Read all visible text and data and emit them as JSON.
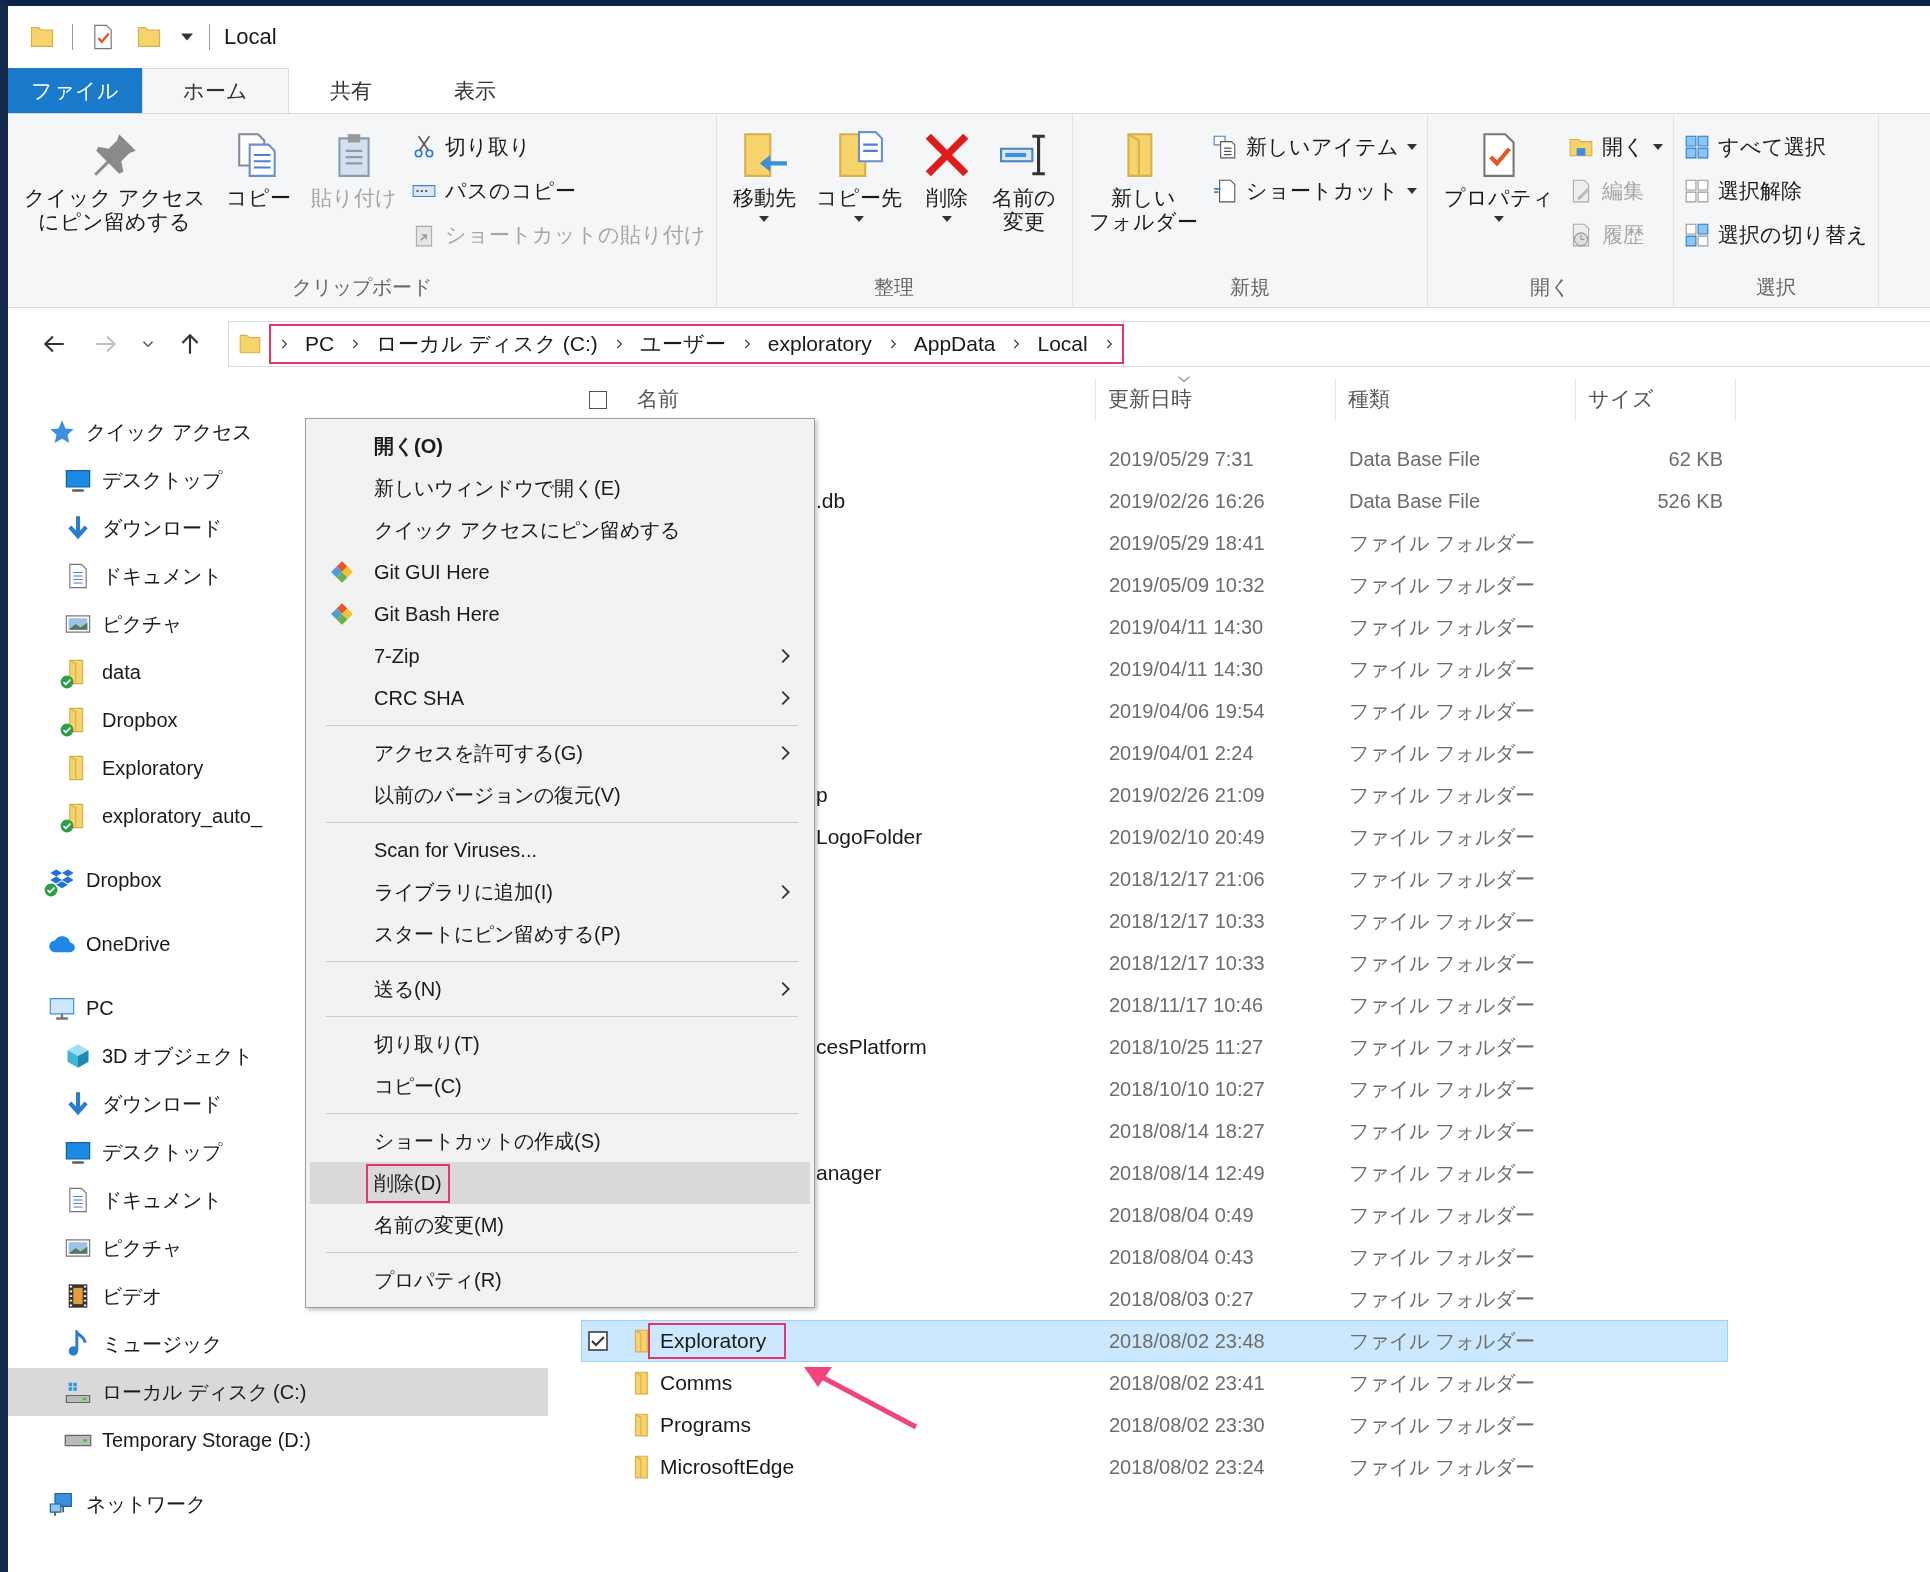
{
  "window": {
    "title": "Local",
    "quick_access": [
      {
        "kind": "folder"
      },
      {
        "kind": "properties"
      },
      {
        "kind": "newfolder"
      },
      {
        "kind": "customize"
      }
    ]
  },
  "tabs": [
    {
      "label": "ファイル",
      "kind": "file",
      "selected": false
    },
    {
      "label": "ホーム",
      "kind": "tab",
      "selected": true
    },
    {
      "label": "共有",
      "kind": "tab",
      "selected": false
    },
    {
      "label": "表示",
      "kind": "tab",
      "selected": false
    }
  ],
  "ribbon": {
    "groups": [
      {
        "label": "クリップボード",
        "large": [
          {
            "lines": [
              "クイック アクセス",
              "にピン留めする"
            ],
            "kind": "pin",
            "disabled": false,
            "dropdown": false
          },
          {
            "lines": [
              "コピー"
            ],
            "kind": "copy",
            "disabled": false,
            "dropdown": false
          },
          {
            "lines": [
              "貼り付け"
            ],
            "kind": "paste",
            "disabled": true,
            "dropdown": false
          }
        ],
        "small": [
          {
            "label": "切り取り",
            "kind": "cut",
            "disabled": false,
            "dropdown": false
          },
          {
            "label": "パスのコピー",
            "kind": "copypath",
            "disabled": false,
            "dropdown": false
          },
          {
            "label": "ショートカットの貼り付け",
            "kind": "pasteshortcut",
            "disabled": true,
            "dropdown": false
          }
        ]
      },
      {
        "label": "整理",
        "large": [
          {
            "lines": [
              "移動先"
            ],
            "kind": "moveto",
            "disabled": false,
            "dropdown": true
          },
          {
            "lines": [
              "コピー先"
            ],
            "kind": "copyto",
            "disabled": false,
            "dropdown": true
          },
          {
            "lines": [
              "削除"
            ],
            "kind": "delete",
            "disabled": false,
            "dropdown": true
          },
          {
            "lines": [
              "名前の",
              "変更"
            ],
            "kind": "rename",
            "disabled": false,
            "dropdown": false
          }
        ]
      },
      {
        "label": "新規",
        "large": [
          {
            "lines": [
              "新しい",
              "フォルダー"
            ],
            "kind": "newfolder",
            "disabled": false,
            "dropdown": false
          }
        ],
        "small": [
          {
            "label": "新しいアイテム",
            "kind": "newitem",
            "disabled": false,
            "dropdown": true
          },
          {
            "label": "ショートカット",
            "kind": "shortcut",
            "disabled": false,
            "dropdown": true
          }
        ]
      },
      {
        "label": "開く",
        "large": [
          {
            "lines": [
              "プロパティ"
            ],
            "kind": "properties",
            "disabled": false,
            "dropdown": true
          }
        ],
        "small": [
          {
            "label": "開く",
            "kind": "open",
            "disabled": false,
            "dropdown": true
          },
          {
            "label": "編集",
            "kind": "edit",
            "disabled": true,
            "dropdown": false
          },
          {
            "label": "履歴",
            "kind": "history",
            "disabled": true,
            "dropdown": false
          }
        ]
      },
      {
        "label": "選択",
        "small": [
          {
            "label": "すべて選択",
            "kind": "selectall",
            "disabled": false,
            "dropdown": false
          },
          {
            "label": "選択解除",
            "kind": "selectnone",
            "disabled": false,
            "dropdown": false
          },
          {
            "label": "選択の切り替え",
            "kind": "invert",
            "disabled": false,
            "dropdown": false
          }
        ]
      }
    ]
  },
  "address": {
    "buttons": [
      {
        "kind": "back",
        "disabled": false
      },
      {
        "kind": "forward",
        "disabled": true
      },
      {
        "kind": "recent",
        "disabled": false
      },
      {
        "kind": "up",
        "disabled": false
      }
    ],
    "segments": [
      "PC",
      "ローカル ディスク (C:)",
      "ユーザー",
      "exploratory",
      "AppData",
      "Local"
    ],
    "marked": true
  },
  "navigation": {
    "items": [
      {
        "label": "クイック アクセス",
        "kind": "star",
        "selected": false,
        "synced": false,
        "children": [
          {
            "label": "デスクトップ",
            "kind": "desktop",
            "selected": false,
            "synced": false
          },
          {
            "label": "ダウンロード",
            "kind": "download",
            "selected": false,
            "synced": false
          },
          {
            "label": "ドキュメント",
            "kind": "document",
            "selected": false,
            "synced": false
          },
          {
            "label": "ピクチャ",
            "kind": "picture",
            "selected": false,
            "synced": false
          },
          {
            "label": "data",
            "kind": "folder",
            "selected": false,
            "synced": true
          },
          {
            "label": "Dropbox",
            "kind": "folder",
            "selected": false,
            "synced": true
          },
          {
            "label": "Exploratory",
            "kind": "folder",
            "selected": false,
            "synced": false
          },
          {
            "label": "exploratory_auto_",
            "kind": "folder",
            "selected": false,
            "synced": true
          }
        ]
      },
      {
        "label": "Dropbox",
        "kind": "dropbox",
        "selected": false,
        "synced": true
      },
      {
        "label": "OneDrive",
        "kind": "cloud",
        "selected": false,
        "synced": false
      },
      {
        "label": "PC",
        "kind": "pc",
        "selected": false,
        "synced": false,
        "children": [
          {
            "label": "3D オブジェクト",
            "kind": "cube",
            "selected": false,
            "synced": false
          },
          {
            "label": "ダウンロード",
            "kind": "download",
            "selected": false,
            "synced": false
          },
          {
            "label": "デスクトップ",
            "kind": "desktop",
            "selected": false,
            "synced": false
          },
          {
            "label": "ドキュメント",
            "kind": "document",
            "selected": false,
            "synced": false
          },
          {
            "label": "ピクチャ",
            "kind": "picture",
            "selected": false,
            "synced": false
          },
          {
            "label": "ビデオ",
            "kind": "video",
            "selected": false,
            "synced": false
          },
          {
            "label": "ミュージック",
            "kind": "music",
            "selected": false,
            "synced": false
          },
          {
            "label": "ローカル ディスク (C:)",
            "kind": "systemdrive",
            "selected": true,
            "synced": false
          },
          {
            "label": "Temporary Storage (D:)",
            "kind": "drive",
            "selected": false,
            "synced": false
          }
        ]
      },
      {
        "label": "ネットワーク",
        "kind": "network",
        "selected": false,
        "synced": false
      }
    ]
  },
  "files": {
    "select_all": {
      "checked": false
    },
    "columns": [
      {
        "label": "名前",
        "sorted": false
      },
      {
        "label": "更新日時",
        "sorted": true
      },
      {
        "label": "種類",
        "sorted": false
      },
      {
        "label": "サイズ",
        "sorted": false
      }
    ],
    "rows": [
      {
        "kind": "clipped",
        "date": "2019/05/29 7:31",
        "type": "Data Base File",
        "size": "62 KB",
        "selected": false,
        "marked": false
      },
      {
        "kind": "clipped",
        "name": ".db",
        "date": "2019/02/26 16:26",
        "type": "Data Base File",
        "size": "526 KB",
        "selected": false,
        "marked": false
      },
      {
        "kind": "clipped",
        "date": "2019/05/29 18:41",
        "type": "ファイル フォルダー",
        "selected": false,
        "marked": false
      },
      {
        "kind": "clipped",
        "date": "2019/05/09 10:32",
        "type": "ファイル フォルダー",
        "selected": false,
        "marked": false
      },
      {
        "kind": "clipped",
        "date": "2019/04/11 14:30",
        "type": "ファイル フォルダー",
        "selected": false,
        "marked": false
      },
      {
        "kind": "clipped",
        "date": "2019/04/11 14:30",
        "type": "ファイル フォルダー",
        "selected": false,
        "marked": false
      },
      {
        "kind": "clipped",
        "date": "2019/04/06 19:54",
        "type": "ファイル フォルダー",
        "selected": false,
        "marked": false
      },
      {
        "kind": "clipped",
        "date": "2019/04/01 2:24",
        "type": "ファイル フォルダー",
        "selected": false,
        "marked": false
      },
      {
        "kind": "clipped",
        "name": "p",
        "date": "2019/02/26 21:09",
        "type": "ファイル フォルダー",
        "selected": false,
        "marked": false
      },
      {
        "kind": "clipped",
        "name": "LogoFolder",
        "date": "2019/02/10 20:49",
        "type": "ファイル フォルダー",
        "selected": false,
        "marked": false
      },
      {
        "kind": "clipped",
        "date": "2018/12/17 21:06",
        "type": "ファイル フォルダー",
        "selected": false,
        "marked": false
      },
      {
        "kind": "clipped",
        "date": "2018/12/17 10:33",
        "type": "ファイル フォルダー",
        "selected": false,
        "marked": false
      },
      {
        "kind": "clipped",
        "date": "2018/12/17 10:33",
        "type": "ファイル フォルダー",
        "selected": false,
        "marked": false
      },
      {
        "kind": "clipped",
        "date": "2018/11/17 10:46",
        "type": "ファイル フォルダー",
        "selected": false,
        "marked": false
      },
      {
        "kind": "clipped",
        "name": "cesPlatform",
        "date": "2018/10/25 11:27",
        "type": "ファイル フォルダー",
        "selected": false,
        "marked": false
      },
      {
        "kind": "clipped",
        "date": "2018/10/10 10:27",
        "type": "ファイル フォルダー",
        "selected": false,
        "marked": false
      },
      {
        "kind": "clipped",
        "date": "2018/08/14 18:27",
        "type": "ファイル フォルダー",
        "selected": false,
        "marked": false
      },
      {
        "kind": "clipped",
        "name": "anager",
        "date": "2018/08/14 12:49",
        "type": "ファイル フォルダー",
        "selected": false,
        "marked": false
      },
      {
        "kind": "clipped",
        "date": "2018/08/04 0:49",
        "type": "ファイル フォルダー",
        "selected": false,
        "marked": false
      },
      {
        "kind": "clipped",
        "date": "2018/08/04 0:43",
        "type": "ファイル フォルダー",
        "selected": false,
        "marked": false
      },
      {
        "kind": "clipped",
        "date": "2018/08/03 0:27",
        "type": "ファイル フォルダー",
        "selected": false,
        "marked": false
      },
      {
        "kind": "folder",
        "name": "Exploratory",
        "date": "2018/08/02 23:48",
        "type": "ファイル フォルダー",
        "selected": true,
        "marked": true
      },
      {
        "kind": "folder",
        "name": "Comms",
        "date": "2018/08/02 23:41",
        "type": "ファイル フォルダー",
        "selected": false,
        "marked": false
      },
      {
        "kind": "folder",
        "name": "Programs",
        "date": "2018/08/02 23:30",
        "type": "ファイル フォルダー",
        "selected": false,
        "marked": false
      },
      {
        "kind": "folder",
        "name": "MicrosoftEdge",
        "date": "2018/08/02 23:24",
        "type": "ファイル フォルダー",
        "selected": false,
        "marked": false
      }
    ]
  },
  "context_menu": {
    "items": [
      {
        "kind": "item",
        "label": "開く(O)",
        "default": true,
        "submenu": false,
        "hover": false,
        "marked": false
      },
      {
        "kind": "item",
        "label": "新しいウィンドウで開く(E)",
        "default": false,
        "submenu": false,
        "hover": false,
        "marked": false
      },
      {
        "kind": "item",
        "label": "クイック アクセスにピン留めする",
        "default": false,
        "submenu": false,
        "hover": false,
        "marked": false
      },
      {
        "kind": "git",
        "label": "Git GUI Here",
        "default": false,
        "submenu": false,
        "hover": false,
        "marked": false
      },
      {
        "kind": "git",
        "label": "Git Bash Here",
        "default": false,
        "submenu": false,
        "hover": false,
        "marked": false
      },
      {
        "kind": "item",
        "label": "7-Zip",
        "default": false,
        "submenu": true,
        "hover": false,
        "marked": false
      },
      {
        "kind": "item",
        "label": "CRC SHA",
        "default": false,
        "submenu": true,
        "hover": false,
        "marked": false
      },
      {
        "kind": "separator"
      },
      {
        "kind": "item",
        "label": "アクセスを許可する(G)",
        "default": false,
        "submenu": true,
        "hover": false,
        "marked": false
      },
      {
        "kind": "item",
        "label": "以前のバージョンの復元(V)",
        "default": false,
        "submenu": false,
        "hover": false,
        "marked": false
      },
      {
        "kind": "separator"
      },
      {
        "kind": "item",
        "label": "Scan for Viruses...",
        "default": false,
        "submenu": false,
        "hover": false,
        "marked": false
      },
      {
        "kind": "item",
        "label": "ライブラリに追加(I)",
        "default": false,
        "submenu": true,
        "hover": false,
        "marked": false
      },
      {
        "kind": "item",
        "label": "スタートにピン留めする(P)",
        "default": false,
        "submenu": false,
        "hover": false,
        "marked": false
      },
      {
        "kind": "separator"
      },
      {
        "kind": "item",
        "label": "送る(N)",
        "default": false,
        "submenu": true,
        "hover": false,
        "marked": false
      },
      {
        "kind": "separator"
      },
      {
        "kind": "item",
        "label": "切り取り(T)",
        "default": false,
        "submenu": false,
        "hover": false,
        "marked": false
      },
      {
        "kind": "item",
        "label": "コピー(C)",
        "default": false,
        "submenu": false,
        "hover": false,
        "marked": false
      },
      {
        "kind": "separator"
      },
      {
        "kind": "item",
        "label": "ショートカットの作成(S)",
        "default": false,
        "submenu": false,
        "hover": false,
        "marked": false
      },
      {
        "kind": "item",
        "label": "削除(D)",
        "default": false,
        "submenu": false,
        "hover": true,
        "marked": true
      },
      {
        "kind": "item",
        "label": "名前の変更(M)",
        "default": false,
        "submenu": false,
        "hover": false,
        "marked": false
      },
      {
        "kind": "separator"
      },
      {
        "kind": "item",
        "label": "プロパティ(R)",
        "default": false,
        "submenu": false,
        "hover": false,
        "marked": false
      }
    ]
  }
}
